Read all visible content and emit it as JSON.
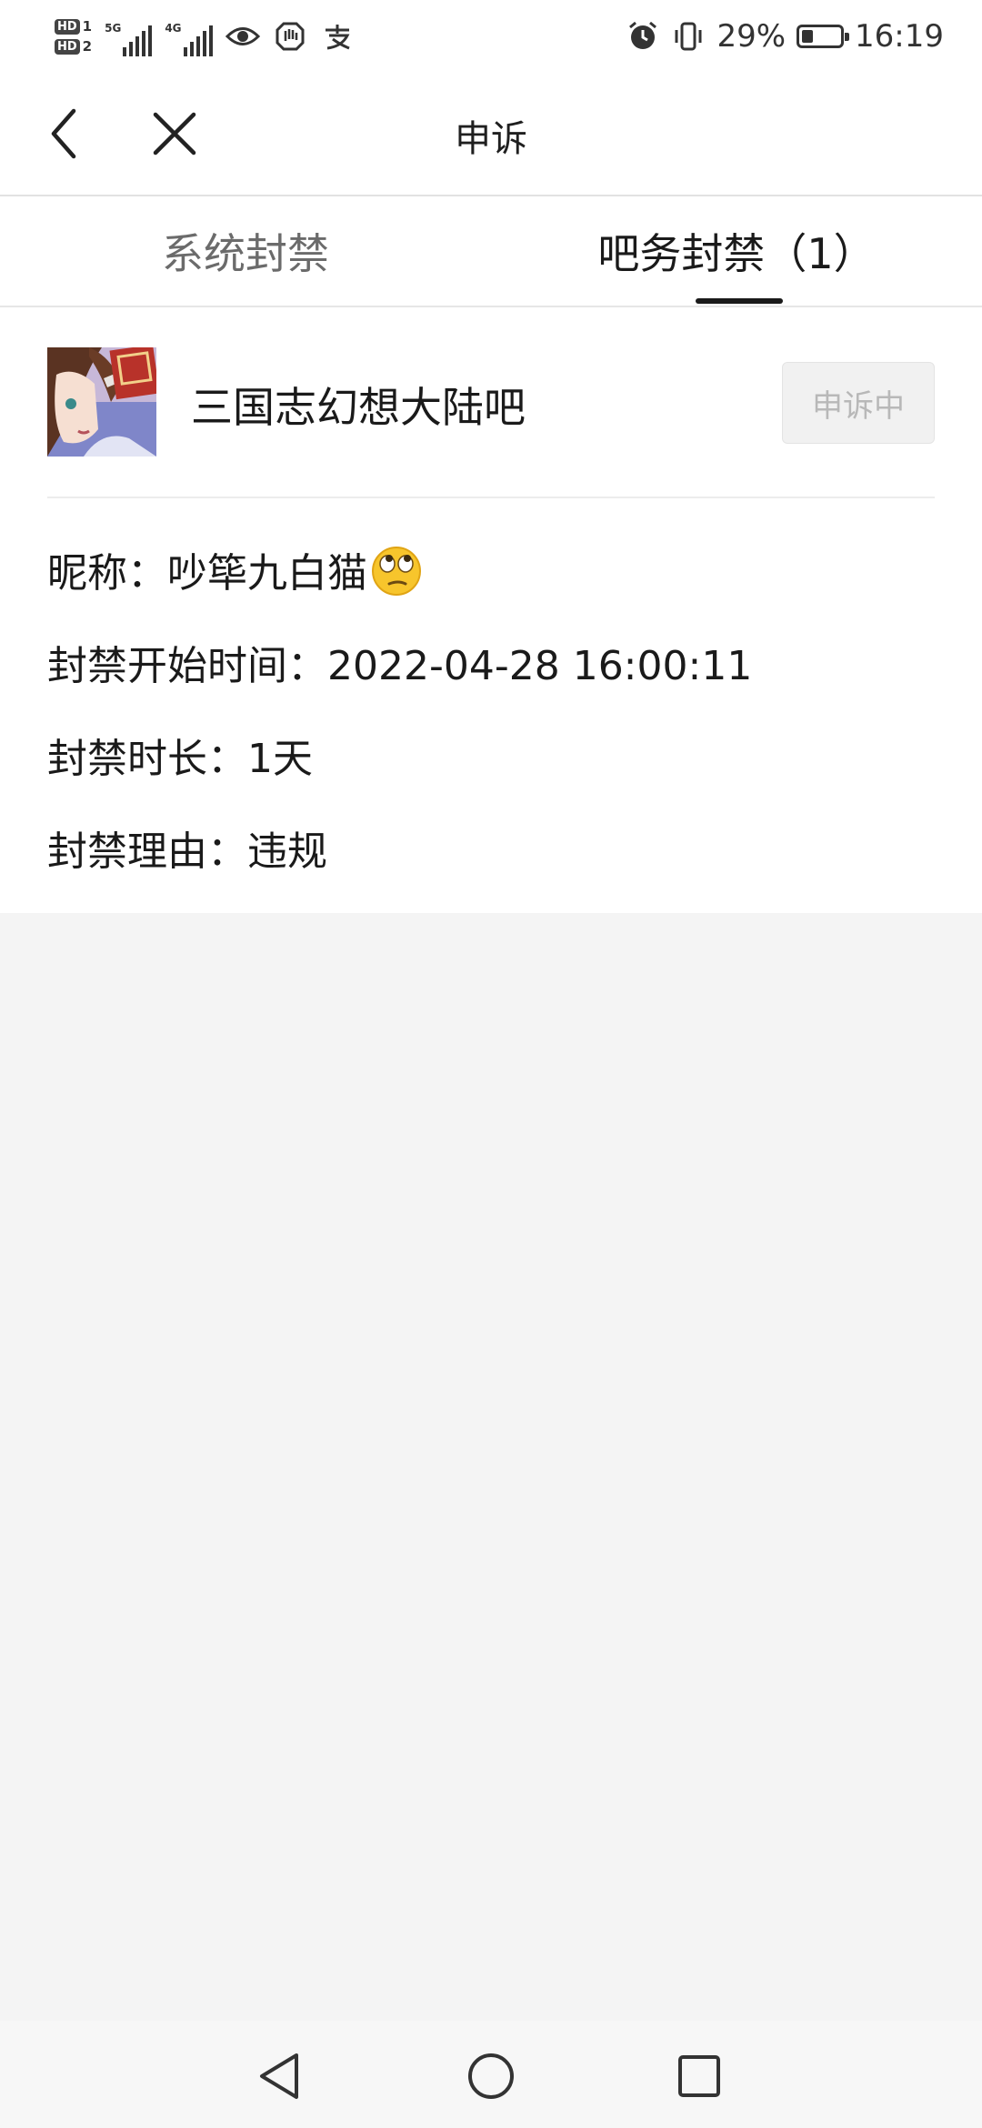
{
  "status_bar": {
    "sim1": "HD",
    "sim1_num": "1",
    "sim2": "HD",
    "sim2_num": "2",
    "net1": "5G",
    "net2": "4G",
    "battery_text": "29%",
    "battery_level": 0.29,
    "time": "16:19",
    "icons": [
      "eye-icon",
      "hand-icon",
      "pay-icon",
      "alarm-icon",
      "vibrate-icon"
    ]
  },
  "header": {
    "title": "申诉",
    "back_icon": "chevron-left-icon",
    "close_icon": "close-icon"
  },
  "tabs": [
    {
      "label": "系统封禁",
      "active": false
    },
    {
      "label": "吧务封禁（1）",
      "active": true
    }
  ],
  "ban_card": {
    "forum_name": "三国志幻想大陆吧",
    "appeal_status": "申诉中",
    "nickname_label": "昵称：",
    "nickname": "吵筚九白猫",
    "start_label": "封禁开始时间：",
    "start_time": "2022-04-28 16:00:11",
    "duration_label": "封禁时长：",
    "duration": "1天",
    "reason_label": "封禁理由：",
    "reason": "违规"
  },
  "nav_bar": {
    "icons": [
      "back-triangle-icon",
      "home-circle-icon",
      "recents-square-icon"
    ]
  }
}
